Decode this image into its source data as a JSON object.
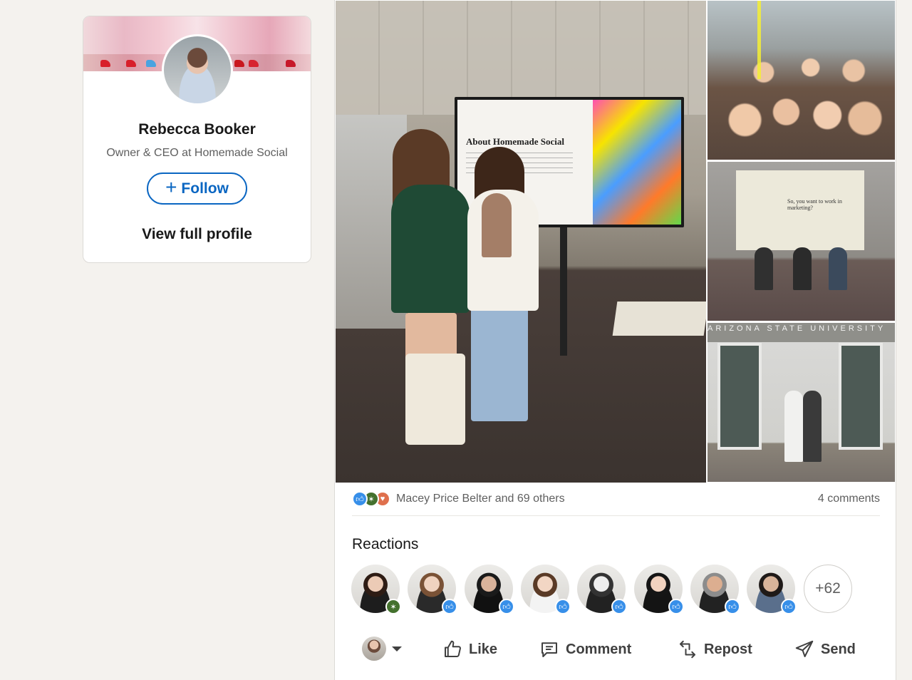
{
  "profile": {
    "name": "Rebecca Booker",
    "headline": "Owner & CEO at Homemade Social",
    "follow_label": "Follow",
    "follow_icon": "plus-icon",
    "view_profile_label": "View full profile"
  },
  "post": {
    "slide_title": "About Homemade Social",
    "panel_screen_text": "So, you want to work in marketing?",
    "building_sign": "ARIZONA STATE UNIVERSITY",
    "social_counts": {
      "reactions_text": "Macey Price Belter and 69 others",
      "comments_text": "4 comments",
      "reaction_types": [
        "like-icon",
        "celebrate-icon",
        "love-icon"
      ]
    },
    "reactions": {
      "heading": "Reactions",
      "reactors": [
        {
          "badge": "celebrate",
          "skin": "#eccbb6",
          "hair": "#2e1c14",
          "shirt": "#1d1d1d"
        },
        {
          "badge": "like",
          "skin": "#f0d3c0",
          "hair": "#7a5236",
          "shirt": "#2a2a2a"
        },
        {
          "badge": "like",
          "skin": "#d9b39b",
          "hair": "#1a1a1a",
          "shirt": "#111111"
        },
        {
          "badge": "like",
          "skin": "#f2d6c4",
          "hair": "#5a3a26",
          "shirt": "#f3f3f3"
        },
        {
          "badge": "like",
          "skin": "#eeeeee",
          "hair": "#333333",
          "shirt": "#222222"
        },
        {
          "badge": "like",
          "skin": "#f1d2bf",
          "hair": "#151515",
          "shirt": "#141414"
        },
        {
          "badge": "like",
          "skin": "#dcae90",
          "hair": "#8c8c8c",
          "shirt": "#222222"
        },
        {
          "badge": "like",
          "skin": "#d8b49a",
          "hair": "#1f1a18",
          "shirt": "#5a6f8c"
        }
      ],
      "more_label": "+62"
    },
    "actions": {
      "like": "Like",
      "comment": "Comment",
      "repost": "Repost",
      "send": "Send"
    }
  }
}
